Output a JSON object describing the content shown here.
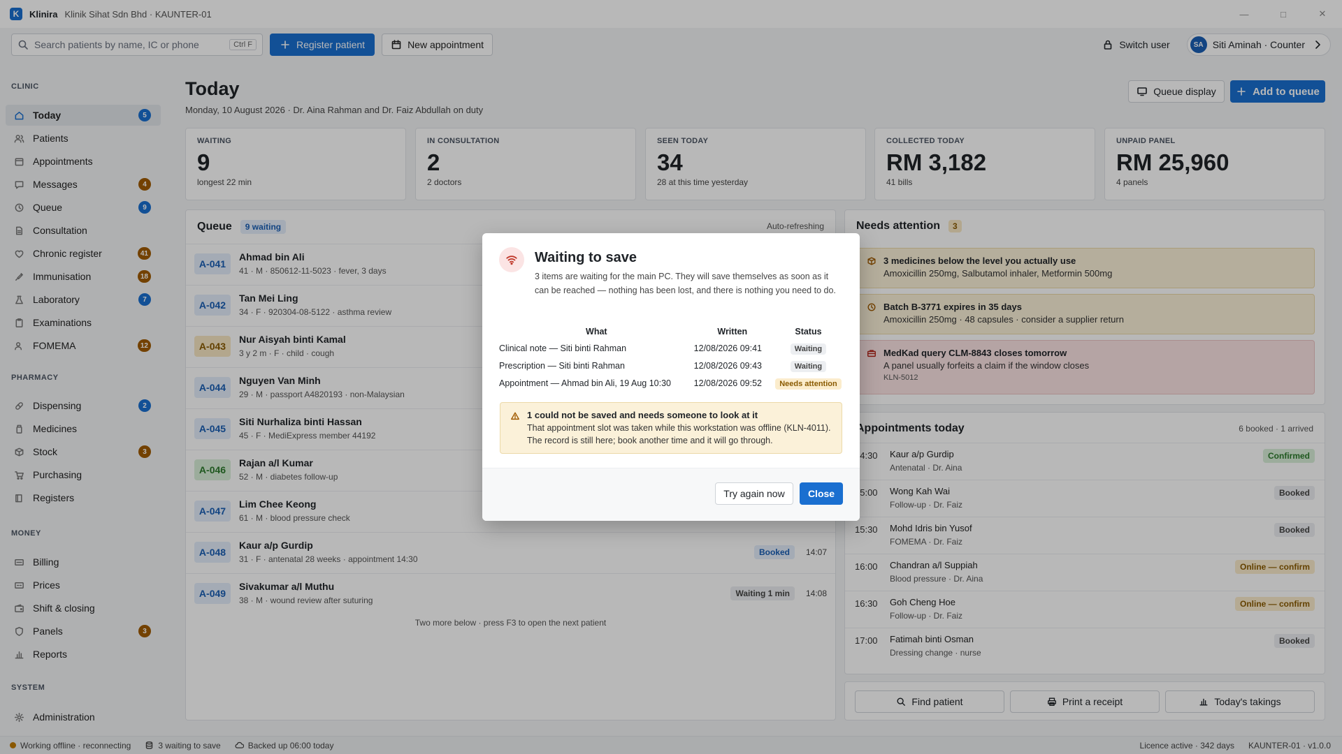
{
  "titlebar": {
    "logo_letter": "K",
    "app_name": "Klinira",
    "context": "Klinik Sihat Sdn Bhd · KAUNTER-01"
  },
  "toolbar": {
    "search_placeholder": "Search patients by name, IC or phone",
    "search_shortcut": "Ctrl F",
    "register_label": "Register patient",
    "new_appointment_label": "New appointment",
    "switch_user_label": "Switch user",
    "user_initials": "SA",
    "user_label": "Siti Aminah · Counter"
  },
  "sidebar": {
    "sections": {
      "clinic": "CLINIC",
      "pharmacy": "PHARMACY",
      "money": "MONEY",
      "system": "SYSTEM"
    },
    "items": [
      {
        "label": "Today",
        "badge": "5"
      },
      {
        "label": "Patients"
      },
      {
        "label": "Appointments"
      },
      {
        "label": "Messages",
        "badge": "4"
      },
      {
        "label": "Queue",
        "badge": "9"
      },
      {
        "label": "Consultation"
      },
      {
        "label": "Chronic register",
        "badge": "41"
      },
      {
        "label": "Immunisation",
        "badge": "18"
      },
      {
        "label": "Laboratory",
        "badge": "7"
      },
      {
        "label": "Examinations"
      },
      {
        "label": "FOMEMA",
        "badge": "12"
      },
      {
        "label": "Dispensing",
        "badge": "2"
      },
      {
        "label": "Medicines"
      },
      {
        "label": "Stock",
        "badge": "3"
      },
      {
        "label": "Purchasing"
      },
      {
        "label": "Registers"
      },
      {
        "label": "Billing"
      },
      {
        "label": "Prices"
      },
      {
        "label": "Shift & closing"
      },
      {
        "label": "Panels",
        "badge": "3"
      },
      {
        "label": "Reports"
      },
      {
        "label": "Administration"
      }
    ]
  },
  "header": {
    "title": "Today",
    "subtitle": "Monday, 10 August 2026 · Dr. Aina Rahman and Dr. Faiz Abdullah on duty",
    "queue_display_label": "Queue display",
    "add_to_queue_label": "Add to queue"
  },
  "stats": [
    {
      "label": "WAITING",
      "value": "9",
      "sub": "longest 22 min"
    },
    {
      "label": "IN CONSULTATION",
      "value": "2",
      "sub": "2 doctors"
    },
    {
      "label": "SEEN TODAY",
      "value": "34",
      "sub": "28 at this time yesterday"
    },
    {
      "label": "COLLECTED TODAY",
      "value": "RM 3,182",
      "sub": "41 bills"
    },
    {
      "label": "UNPAID PANEL",
      "value": "RM 25,960",
      "sub": "4 panels"
    }
  ],
  "queue": {
    "title": "Queue",
    "count_pill": "9 waiting",
    "auto_label": "Auto-refreshing",
    "rows": [
      {
        "num": "A-041",
        "name": "Ahmad bin Ali",
        "meta": "41 · M · 850612-11-5023 · fever, 3 days"
      },
      {
        "num": "A-042",
        "name": "Tan Mei Ling",
        "meta": "34 · F · 920304-08-5122 · asthma review"
      },
      {
        "num": "A-043",
        "name": "Nur Aisyah binti Kamal",
        "meta": "3 y 2 m · F · child · cough"
      },
      {
        "num": "A-044",
        "name": "Nguyen Van Minh",
        "meta": "29 · M · passport A4820193 · non-Malaysian"
      },
      {
        "num": "A-045",
        "name": "Siti Nurhaliza binti Hassan",
        "meta": "45 · F · MediExpress member 44192"
      },
      {
        "num": "A-046",
        "name": "Rajan a/l Kumar",
        "meta": "52 · M · diabetes follow-up"
      },
      {
        "num": "A-047",
        "name": "Lim Chee Keong",
        "meta": "61 · M · blood pressure check"
      },
      {
        "num": "A-048",
        "name": "Kaur a/p Gurdip",
        "meta": "31 · F · antenatal 28 weeks · appointment 14:30",
        "status": "Booked",
        "time": "14:07"
      },
      {
        "num": "A-049",
        "name": "Sivakumar a/l Muthu",
        "meta": "38 · M · wound review after suturing",
        "status": "Waiting 1 min",
        "time": "14:08"
      }
    ],
    "footer": "Two more below · press F3 to open the next patient"
  },
  "attention": {
    "title": "Needs attention",
    "count": "3",
    "cards": [
      {
        "title": "3 medicines below the level you actually use",
        "detail": "Amoxicillin 250mg, Salbutamol inhaler, Metformin 500mg"
      },
      {
        "title": "Batch B-3771 expires in 35 days",
        "detail": "Amoxicillin 250mg · 48 capsules · consider a supplier return"
      },
      {
        "title": "MedKad query CLM-8843 closes tomorrow",
        "detail": "A panel usually forfeits a claim if the window closes",
        "code": "KLN-5012"
      }
    ]
  },
  "appointments": {
    "title": "Appointments today",
    "count": "6 booked · 1 arrived",
    "rows": [
      {
        "time": "14:30",
        "name": "Kaur a/p Gurdip",
        "meta": "Antenatal · Dr. Aina",
        "status": "Confirmed"
      },
      {
        "time": "15:00",
        "name": "Wong Kah Wai",
        "meta": "Follow-up · Dr. Faiz",
        "status": "Booked"
      },
      {
        "time": "15:30",
        "name": "Mohd Idris bin Yusof",
        "meta": "FOMEMA · Dr. Faiz",
        "status": "Booked"
      },
      {
        "time": "16:00",
        "name": "Chandran a/l Suppiah",
        "meta": "Blood pressure · Dr. Aina",
        "status": "Online — confirm"
      },
      {
        "time": "16:30",
        "name": "Goh Cheng Hoe",
        "meta": "Follow-up · Dr. Faiz",
        "status": "Online — confirm"
      },
      {
        "time": "17:00",
        "name": "Fatimah binti Osman",
        "meta": "Dressing change · nurse",
        "status": "Booked"
      }
    ]
  },
  "quick_actions": {
    "find": "Find patient",
    "print": "Print a receipt",
    "takings": "Today's takings"
  },
  "statusbar": {
    "connection": "Working offline · reconnecting",
    "pending": "3 waiting to save",
    "backup": "Backed up 06:00 today",
    "licence": "Licence active · 342 days",
    "version": "KAUNTER-01 · v1.0.0"
  },
  "dialog": {
    "title": "Waiting to save",
    "body": "3 items are waiting for the main PC. They will save themselves as soon as it can be reached — nothing has been lost, and there is nothing you need to do.",
    "columns": {
      "what": "What",
      "written": "Written",
      "status": "Status"
    },
    "rows": [
      {
        "what": "Clinical note — Siti binti Rahman",
        "written": "12/08/2026 09:41",
        "status": "Waiting"
      },
      {
        "what": "Prescription — Siti binti Rahman",
        "written": "12/08/2026 09:43",
        "status": "Waiting"
      },
      {
        "what": "Appointment — Ahmad bin Ali, 19 Aug 10:30",
        "written": "12/08/2026 09:52",
        "status": "Needs attention"
      }
    ],
    "warning_title": "1 could not be saved and needs someone to look at it",
    "warning_body": "That appointment slot was taken while this workstation was offline (KLN-4011). The record is still here; book another time and it will go through.",
    "retry_label": "Try again now",
    "close_label": "Close"
  }
}
